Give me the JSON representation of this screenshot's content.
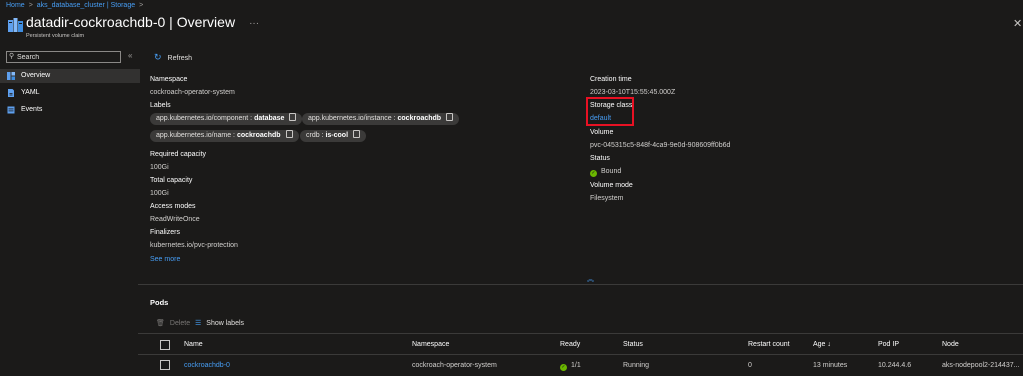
{
  "breadcrumb": [
    "Home",
    "aks_database_cluster | Storage"
  ],
  "header": {
    "title": "datadir-cockroachdb-0 | Overview",
    "subtitle": "Persistent volume claim",
    "more": "···",
    "close": "✕"
  },
  "nav": {
    "search_value": "Search",
    "collapse": "«",
    "items": [
      {
        "label": "Overview",
        "icon_color": "#479ef5"
      },
      {
        "label": "YAML",
        "icon_color": "#479ef5"
      },
      {
        "label": "Events",
        "icon_color": "#479ef5"
      }
    ]
  },
  "toolbar": {
    "refresh": "Refresh"
  },
  "left_props": {
    "namespace_label": "Namespace",
    "namespace": "cockroach-operator-system",
    "labels_label": "Labels",
    "chips": [
      {
        "key": "app.kubernetes.io/component : ",
        "value": "database"
      },
      {
        "key": "app.kubernetes.io/instance : ",
        "value": "cockroachdb"
      },
      {
        "key": "app.kubernetes.io/name : ",
        "value": "cockroachdb"
      },
      {
        "key": "crdb : ",
        "value": "is-cool"
      }
    ],
    "required_capacity_label": "Required capacity",
    "required_capacity": "100Gi",
    "total_capacity_label": "Total capacity",
    "total_capacity": "100Gi",
    "access_modes_label": "Access modes",
    "access_modes": "ReadWriteOnce",
    "finalizers_label": "Finalizers",
    "finalizers": "kubernetes.io/pvc-protection",
    "see_more": "See more"
  },
  "right_props": {
    "creation_time_label": "Creation time",
    "creation_time": "2023-03-10T15:55:45.000Z",
    "storage_class_label": "Storage class",
    "storage_class": "default",
    "volume_label": "Volume",
    "volume": "pvc-045315c5-848f-4ca9-9e0d-908609ff0b6d",
    "status_label": "Status",
    "status": "Bound",
    "volume_mode_label": "Volume mode",
    "volume_mode": "Filesystem"
  },
  "collapse_arrow": "︽",
  "pods": {
    "title": "Pods",
    "delete": "Delete",
    "show_labels": "Show labels",
    "columns": [
      "Name",
      "Namespace",
      "Ready",
      "Status",
      "Restart count",
      "Age ↓",
      "Pod IP",
      "Node"
    ],
    "rows": [
      {
        "name": "cockroachdb-0",
        "namespace": "cockroach-operator-system",
        "ready": "1/1",
        "status": "Running",
        "restart_count": "0",
        "age": "13 minutes",
        "pod_ip": "10.244.4.6",
        "node": "aks-nodepool2-214437..."
      }
    ]
  },
  "colors": {
    "background": "#1b1a19",
    "accent": "#479ef5",
    "highlight_box": "#e81123",
    "success": "#6bb700"
  }
}
